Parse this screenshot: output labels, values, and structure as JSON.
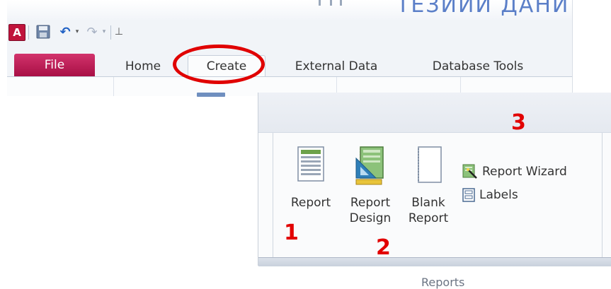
{
  "title_bar": {
    "doc_title_fragment": "ТЕЗИИИ ДАНИ"
  },
  "quick_access": {
    "app_icon_letter": "A",
    "undo_glyph": "↶",
    "redo_glyph": "↷",
    "dropdown_glyph": "▾",
    "customize_glyph": "⊥"
  },
  "tabs": [
    {
      "label": "File"
    },
    {
      "label": "Home"
    },
    {
      "label": "Create"
    },
    {
      "label": "External Data"
    },
    {
      "label": "Database Tools"
    }
  ],
  "reports_group": {
    "report_label": "Report",
    "report_design_label": "Report\nDesign",
    "blank_report_label": "Blank\nReport",
    "report_wizard_label": "Report Wizard",
    "labels_label": "Labels",
    "group_label": "Reports"
  },
  "annotations": {
    "one": "1",
    "two": "2",
    "three": "3"
  },
  "colors": {
    "file_tab": "#c0144a",
    "annotation_red": "#e00000",
    "access_red": "#c0143c"
  }
}
